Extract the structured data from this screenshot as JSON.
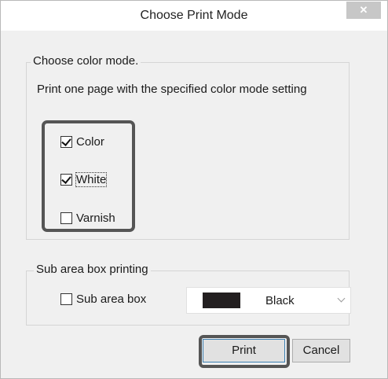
{
  "window": {
    "title": "Choose Print Mode",
    "close_glyph": "✕"
  },
  "color_mode": {
    "group_label": "Choose color mode.",
    "description": "Print one page with the specified color mode setting",
    "options": [
      {
        "label": "Color",
        "checked": true
      },
      {
        "label": "White",
        "checked": true
      },
      {
        "label": "Varnish",
        "checked": false
      }
    ]
  },
  "sub_area": {
    "group_label": "Sub area box printing",
    "checkbox_label": "Sub area box",
    "checked": false,
    "color_value": "Black",
    "swatch_color": "#231f20"
  },
  "buttons": {
    "print": "Print",
    "cancel": "Cancel"
  },
  "icons": {
    "close": "close-icon",
    "dropdown": "chevron-down-icon"
  }
}
